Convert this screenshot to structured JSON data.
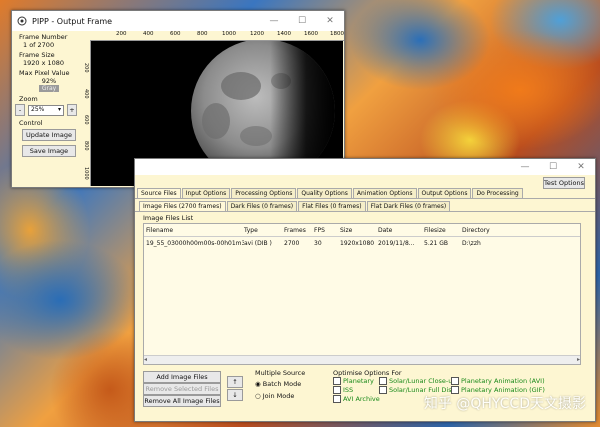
{
  "pipp_window": {
    "title": "PIPP - Output Frame",
    "frame_number_label": "Frame Number",
    "frame_number_value": "1 of 2700",
    "frame_size_label": "Frame Size",
    "frame_size_value": "1920 x 1080",
    "max_pixel_label": "Max Pixel Value",
    "max_pixel_value": "92%",
    "max_pixel_badge": "Gray",
    "zoom_label": "Zoom",
    "zoom_minus": "-",
    "zoom_value": "25%",
    "zoom_plus": "+",
    "control_label": "Control",
    "update_image": "Update Image",
    "save_image": "Save Image",
    "ruler_ticks": [
      "200",
      "400",
      "600",
      "800",
      "1000",
      "1200",
      "1400",
      "1600",
      "1800"
    ],
    "ruler_ticks_v": [
      "200",
      "400",
      "600",
      "800",
      "1000"
    ]
  },
  "main_window": {
    "test_options": "Test Options",
    "tabs": [
      "Source Files",
      "Input Options",
      "Processing Options",
      "Quality Options",
      "Animation Options",
      "Output Options",
      "Do Processing"
    ],
    "subtabs": [
      "Image Files (2700 frames)",
      "Dark Files (0 frames)",
      "Flat Files (0 frames)",
      "Flat Dark Files (0 frames)"
    ],
    "group_label": "Image Files List",
    "columns": [
      "Filename",
      "Type",
      "Frames",
      "FPS",
      "Size",
      "Date",
      "Filesize",
      "Directory"
    ],
    "rows": [
      [
        "19_55_03000h00m00s-00h01m3...",
        "avi (DIB )",
        "2700",
        "30",
        "1920x1080",
        "2019/11/8...",
        "5.21 GB",
        "D:\\zzh"
      ]
    ],
    "add_image_files": "Add Image Files",
    "remove_selected_files": "Remove Selected Files",
    "remove_all_image_files": "Remove All Image Files",
    "multiple_source_label": "Multiple Source",
    "batch_mode": "Batch Mode",
    "join_mode": "Join Mode",
    "optimise_label": "Optimise Options For",
    "opt_planetary": "Planetary",
    "opt_iss": "ISS",
    "opt_avi_archive": "AVI Archive",
    "opt_solar_closeup": "Solar/Lunar Close-up",
    "opt_solar_full": "Solar/Lunar Full Disc",
    "opt_planetary_avi": "Planetary Animation (AVI)",
    "opt_planetary_gif": "Planetary Animation (GIF)"
  },
  "watermark": "知乎 @QHYCCD天文摄影"
}
